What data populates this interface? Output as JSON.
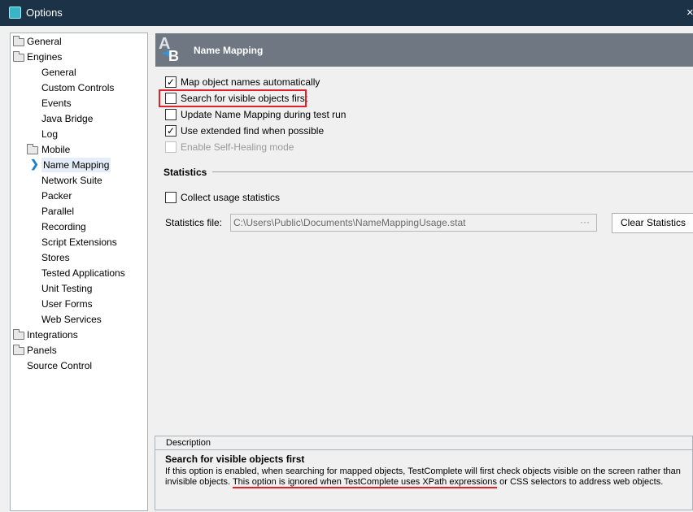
{
  "window": {
    "title": "Options",
    "close": "×"
  },
  "tree": {
    "items": [
      {
        "label": "General",
        "level": 0,
        "folder": true
      },
      {
        "label": "Engines",
        "level": 0,
        "folder": true
      },
      {
        "label": "General",
        "level": 1
      },
      {
        "label": "Custom Controls",
        "level": 1
      },
      {
        "label": "Events",
        "level": 1
      },
      {
        "label": "Java Bridge",
        "level": 1
      },
      {
        "label": "Log",
        "level": 1
      },
      {
        "label": "Mobile",
        "level": 1,
        "folder": true
      },
      {
        "label": "Name Mapping",
        "level": 1,
        "selected": true
      },
      {
        "label": "Network Suite",
        "level": 1
      },
      {
        "label": "Packer",
        "level": 1
      },
      {
        "label": "Parallel",
        "level": 1
      },
      {
        "label": "Recording",
        "level": 1
      },
      {
        "label": "Script Extensions",
        "level": 1
      },
      {
        "label": "Stores",
        "level": 1
      },
      {
        "label": "Tested Applications",
        "level": 1
      },
      {
        "label": "Unit Testing",
        "level": 1
      },
      {
        "label": "User Forms",
        "level": 1
      },
      {
        "label": "Web Services",
        "level": 1
      },
      {
        "label": "Integrations",
        "level": 0,
        "folder": true
      },
      {
        "label": "Panels",
        "level": 0,
        "folder": true
      },
      {
        "label": "Source Control",
        "level": 0
      }
    ]
  },
  "header": {
    "title": "Name Mapping",
    "logo_a": "A",
    "logo_b": "B"
  },
  "options": [
    {
      "label": "Map object names automatically",
      "checked": true,
      "disabled": false
    },
    {
      "label": "Search for visible objects first",
      "checked": false,
      "disabled": false
    },
    {
      "label": "Update Name Mapping during test run",
      "checked": false,
      "disabled": false
    },
    {
      "label": "Use extended find when possible",
      "checked": true,
      "disabled": false
    },
    {
      "label": "Enable Self-Healing mode",
      "checked": false,
      "disabled": true
    }
  ],
  "statistics": {
    "title": "Statistics",
    "collect_label": "Collect usage statistics",
    "file_label": "Statistics file:",
    "file_value": "C:\\Users\\Public\\Documents\\NameMappingUsage.stat",
    "browse": "···",
    "clear_button": "Clear Statistics"
  },
  "description": {
    "header": "Description",
    "title": "Search for visible objects first",
    "text1": "If this option is enabled, when searching for mapped objects, TestComplete will first check objects visible on the screen rather than invisible objects. ",
    "text_underlined": "This option is ignored when TestComplete uses XPath expressions",
    "text2": " or CSS selectors to address web objects."
  }
}
